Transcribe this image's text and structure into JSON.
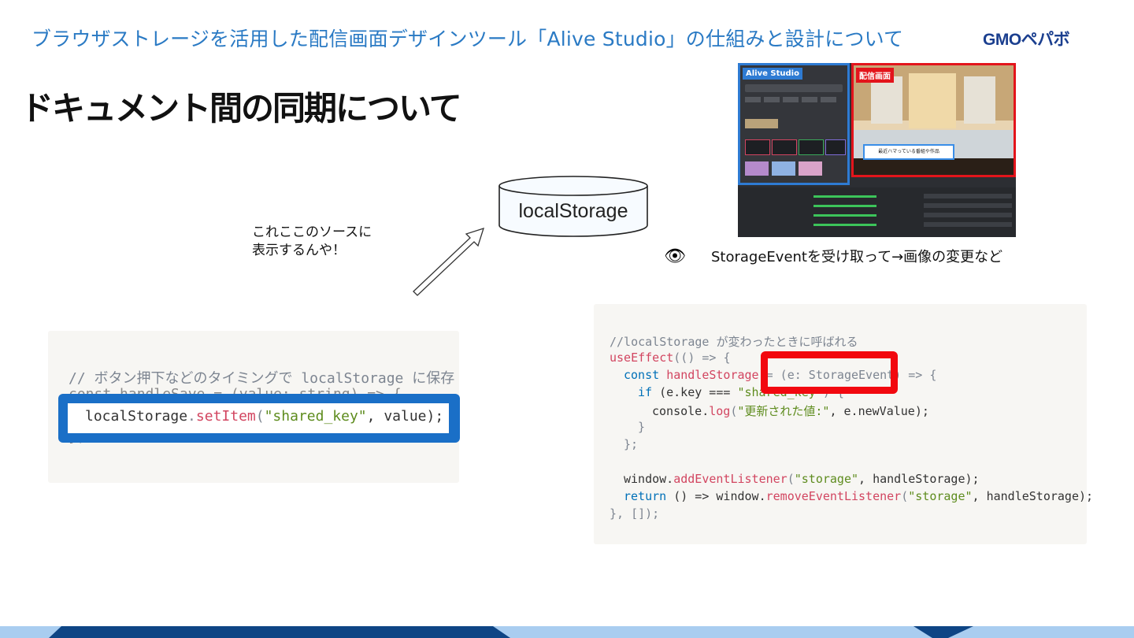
{
  "header": {
    "title": "ブラウザストレージを活用した配信画面デザインツール「Alive Studio」の仕組みと設計について",
    "brand": "GMOペパボ"
  },
  "section_heading": "ドキュメント間の同期について",
  "storage": {
    "label": "localStorage"
  },
  "speech": {
    "line1": "これここのソースに",
    "line2": "表示するんや！"
  },
  "screenshot": {
    "left_badge": "Alive Studio",
    "right_badge": "配信画面",
    "caption": "最近ハマっている番組や作品"
  },
  "note": "StorageEventを受け取って→画像の変更など",
  "code_left": {
    "comment": "// ボタン押下などのタイミングで localStorage に保存",
    "line2": "const handleSave = (value: string) => {",
    "call_obj": "localStorage",
    "call_dot": ".",
    "call_fn": "setItem",
    "call_open": "(",
    "call_arg1": "\"shared_key\"",
    "call_rest": ", value);",
    "line4": "};"
  },
  "code_right": {
    "l1": "//localStorage が変わったときに呼ばれる",
    "l2_fn": "useEffect",
    "l2_rest": "(() => {",
    "l3_kw": "const",
    "l3_fn": "handleStorage",
    "l3_mid": " = (e: StorageEvent) => {",
    "l4_kw": "if",
    "l4_mid": " (e.key === ",
    "l4_str": "\"shared_key\"",
    "l4_end": ") {",
    "l5_obj": "console.",
    "l5_fn": "log",
    "l5_open": "(",
    "l5_str": "\"更新された値:\"",
    "l5_end": ", e.newValue);",
    "l6": "}",
    "l7": "};",
    "l9_obj": "window.",
    "l9_fn": "addEventListener",
    "l9_open": "(",
    "l9_str": "\"storage\"",
    "l9_end": ", handleStorage);",
    "l10_kw": "return",
    "l10_mid": " () => window.",
    "l10_fn": "removeEventListener",
    "l10_open": "(",
    "l10_str": "\"storage\"",
    "l10_end": ", handleStorage);",
    "l11": "}, []);"
  },
  "colors": {
    "title_blue": "#2a7ac4",
    "highlight_blue": "#1a6fc7",
    "highlight_red": "#f2080f",
    "footer_dark": "#0e4585",
    "footer_light": "#a9cdf0"
  }
}
